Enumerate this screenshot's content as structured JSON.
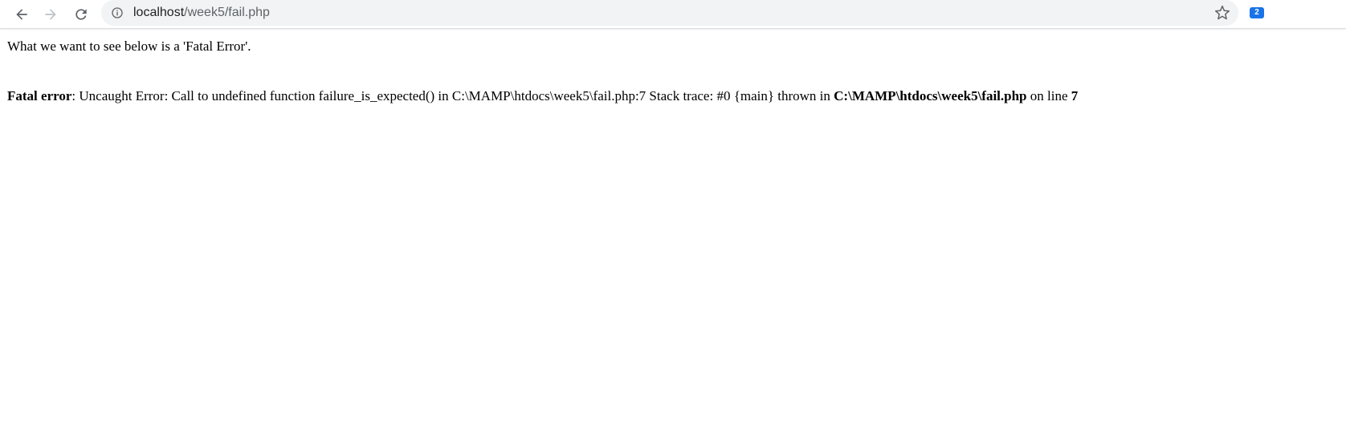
{
  "browser": {
    "url_host": "localhost",
    "url_path": "/week5/fail.php",
    "extension_badge": "2"
  },
  "page": {
    "intro_text": "What we want to see below is a 'Fatal Error'.",
    "error": {
      "label": "Fatal error",
      "message": ": Uncaught Error: Call to undefined function failure_is_expected() in C:\\MAMP\\htdocs\\week5\\fail.php:7 Stack trace: #0 {main} thrown in ",
      "file": "C:\\MAMP\\htdocs\\week5\\fail.php",
      "on_line_text": " on line ",
      "line": "7"
    }
  },
  "icons": {
    "back": "arrow-left-icon",
    "forward": "arrow-right-icon",
    "reload": "reload-icon",
    "site_info": "info-icon",
    "bookmark": "star-icon"
  }
}
